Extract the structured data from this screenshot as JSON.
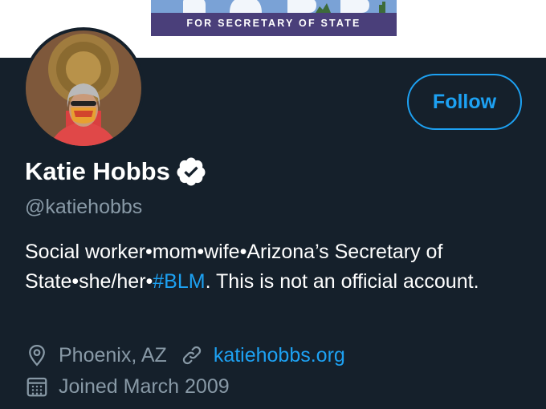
{
  "banner": {
    "tagline": "FOR SECRETARY OF STATE"
  },
  "profile": {
    "avatar_icon": "profile-photo",
    "follow_label": "Follow",
    "name": "Katie Hobbs",
    "verified_icon": "verified-badge-icon",
    "handle": "@katiehobbs",
    "bio": {
      "part1": "Social worker•mom•wife•Arizona’s Secretary of State•she/her•",
      "hashtag": "#BLM",
      "part2": ". This is not an official account."
    },
    "location_icon": "location-pin-icon",
    "location": "Phoenix, AZ",
    "link_icon": "link-icon",
    "website": "katiehobbs.org",
    "calendar_icon": "calendar-icon",
    "joined": "Joined March 2009"
  },
  "colors": {
    "background": "#15202b",
    "accent": "#1da1f2",
    "secondary_text": "#8899a6",
    "banner_purple": "#4a3f7a"
  }
}
